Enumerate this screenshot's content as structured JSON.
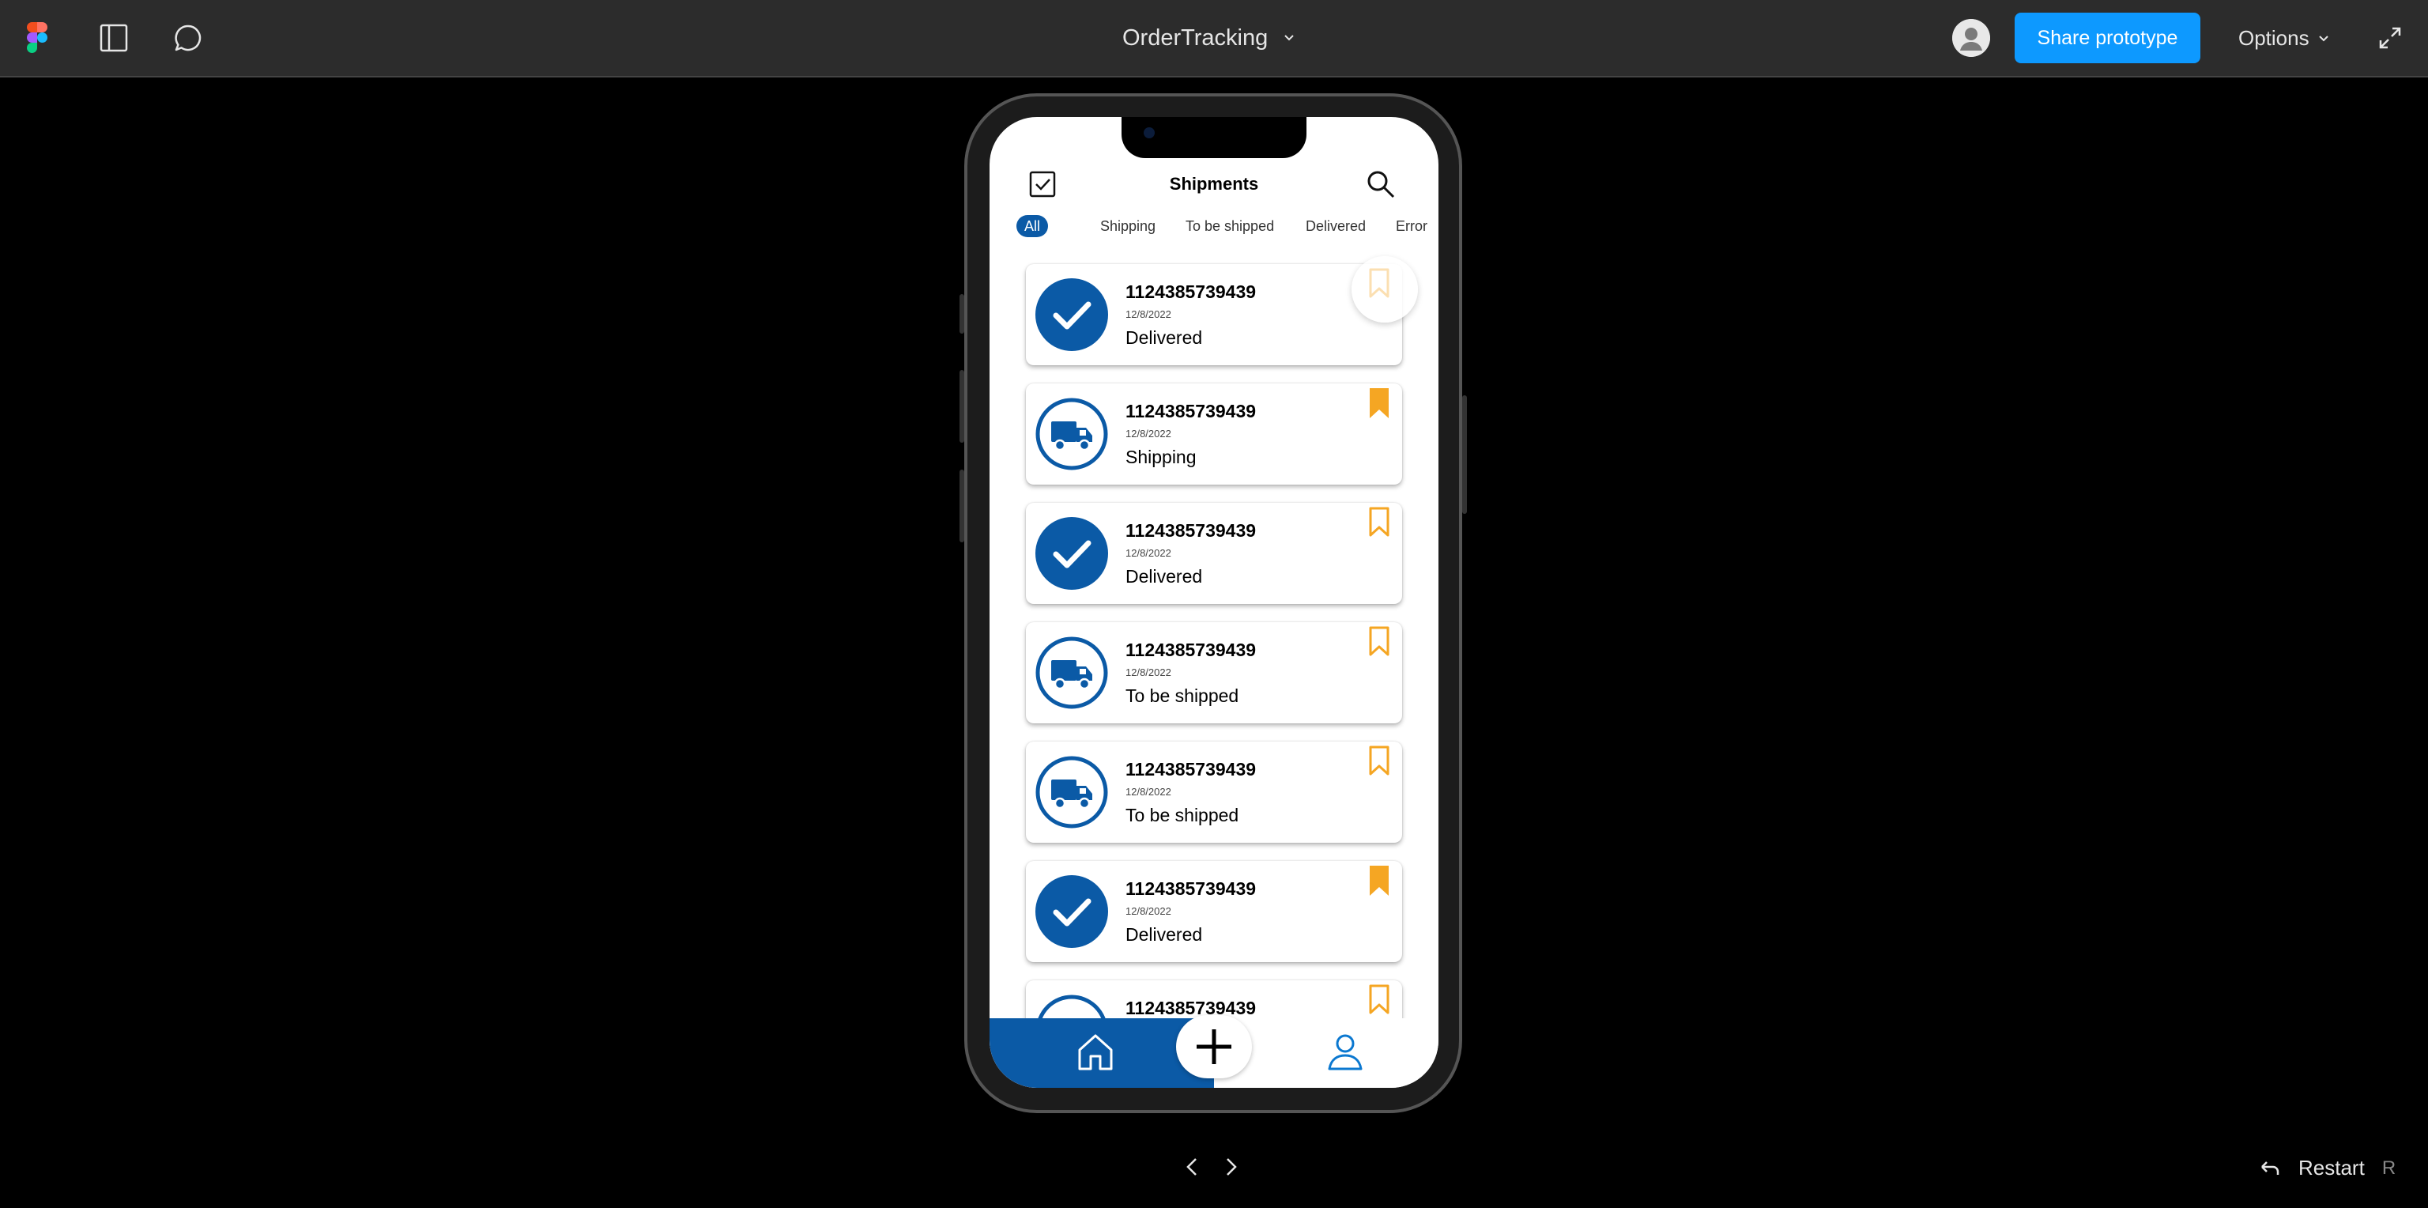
{
  "toolbar": {
    "file_title": "OrderTracking",
    "share_label": "Share prototype",
    "options_label": "Options",
    "icons": [
      "figma-logo",
      "sidebar-icon",
      "comment-icon",
      "chevron-down-icon",
      "avatar",
      "expand-icon"
    ]
  },
  "app": {
    "title": "Shipments",
    "filters": [
      "All",
      "Shipping",
      "To be shipped",
      "Delivered",
      "Error"
    ],
    "active_filter": "All",
    "shipments": [
      {
        "number": "1124385739439",
        "date": "12/8/2022",
        "status": "Delivered",
        "icon": "check-icon",
        "bookmarked": false
      },
      {
        "number": "1124385739439",
        "date": "12/8/2022",
        "status": "Shipping",
        "icon": "truck-icon",
        "bookmarked": true
      },
      {
        "number": "1124385739439",
        "date": "12/8/2022",
        "status": "Delivered",
        "icon": "check-icon",
        "bookmarked": false
      },
      {
        "number": "1124385739439",
        "date": "12/8/2022",
        "status": "To be shipped",
        "icon": "truck-icon",
        "bookmarked": false
      },
      {
        "number": "1124385739439",
        "date": "12/8/2022",
        "status": "To be shipped",
        "icon": "truck-icon",
        "bookmarked": false
      },
      {
        "number": "1124385739439",
        "date": "12/8/2022",
        "status": "Delivered",
        "icon": "check-icon",
        "bookmarked": true
      },
      {
        "number": "1124385739439",
        "date": "",
        "status": "",
        "icon": "truck-icon",
        "bookmarked": false
      }
    ],
    "bottom_nav": [
      "home-icon",
      "plus-icon",
      "profile-icon"
    ]
  },
  "footer": {
    "restart_label": "Restart",
    "restart_key": "R"
  },
  "colors": {
    "toolbar_bg": "#2c2c2c",
    "share_blue": "#0d99ff",
    "brand_blue": "#0b5aa6",
    "bookmark_orange": "#f5a623"
  }
}
